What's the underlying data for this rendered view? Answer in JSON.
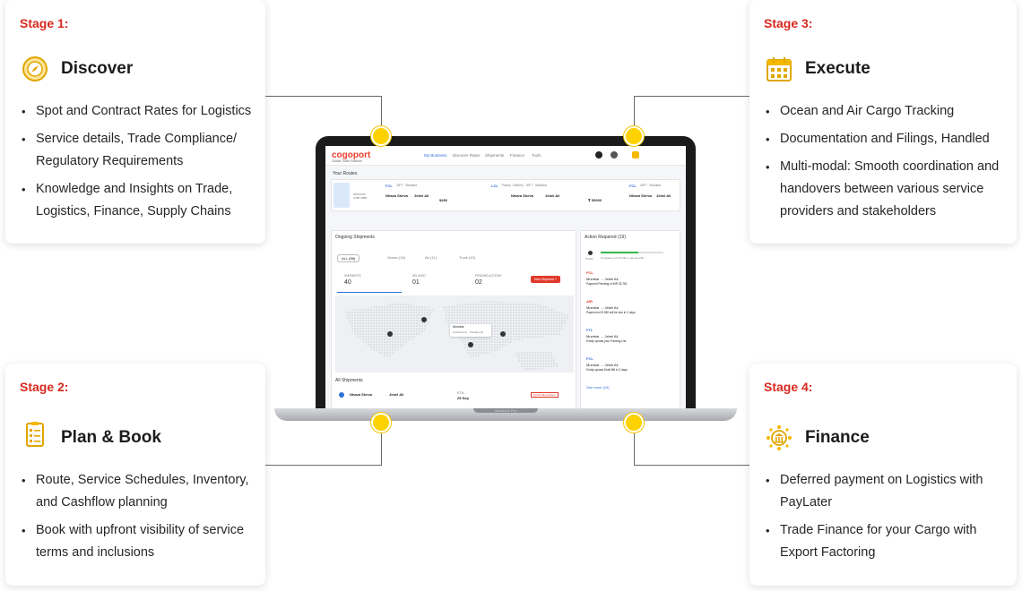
{
  "stages": [
    {
      "label": "Stage 1:",
      "title": "Discover",
      "icon": "compass-icon",
      "bullets": [
        "Spot and Contract Rates for Logistics",
        "Service details, Trade Compliance/ Regulatory Requirements",
        "Knowledge and Insights on Trade, Logistics, Finance, Supply Chains"
      ]
    },
    {
      "label": "Stage 2:",
      "title": "Plan & Book",
      "icon": "clipboard-checklist-icon",
      "bullets": [
        "Route, Service Schedules, Inventory, and Cashflow planning",
        "Book with upfront visibility of service terms and inclusions"
      ]
    },
    {
      "label": "Stage 3:",
      "title": "Execute",
      "icon": "calendar-icon",
      "bullets": [
        "Ocean and Air Cargo Tracking",
        "Documentation and Filings, Handled",
        "Multi-modal: Smooth coordination and handovers between various service providers and stakeholders"
      ]
    },
    {
      "label": "Stage 4:",
      "title": "Finance",
      "icon": "bank-network-icon",
      "bullets": [
        "Deferred payment on Logistics with PayLater",
        "Trade Finance for your Cargo with Export Factoring"
      ]
    }
  ],
  "colors": {
    "accent_red": "#d8281e",
    "connector_yellow": "#fdd200",
    "icon_yellow": "#f5b800"
  },
  "screen": {
    "logo": "cogoport",
    "logo_sub": "Global Trade Platform",
    "nav": [
      "My Business",
      "Discover Rates",
      "Shipments",
      "Finance",
      "Tools"
    ],
    "your_routes": "Your Routes",
    "add_route": "Add more route rates",
    "routes": [
      {
        "mode": "FCL",
        "meta": "20FT · Standard",
        "origin": "Nhava Sheva",
        "origin_city": "Mumbai",
        "dest": "Jebel Ali",
        "dest_city": "Dubai",
        "price": "$490"
      },
      {
        "mode": "LCL",
        "meta": "Pickup · Delivery · 20FT · Standard",
        "origin": "Nhava Sheva",
        "origin_city": "Mumbai",
        "dest": "Jebel Ali",
        "dest_city": "Dubai",
        "price": "₹ 53000"
      },
      {
        "mode": "FCL",
        "meta": "40FT · Standard",
        "origin": "Nhava Sheva",
        "origin_city": "Mumbai",
        "dest": "Jebel Ali",
        "dest_city": "Dubai",
        "price": ""
      }
    ],
    "ongoing_title": "Ongoing Shipments",
    "filters": [
      "ALL (88)",
      "Ocean (15)",
      "Air (11)",
      "Truck (10)"
    ],
    "stats": [
      {
        "label": "SHIPMENTS",
        "value": "40"
      },
      {
        "label": "DELAYED",
        "value": "01"
      },
      {
        "label": "PENDING ACTIONS",
        "value": "02"
      }
    ],
    "new_shipment": "New Shipment  +",
    "map_tooltip": "Mumbai",
    "map_tooltip_sub": "Onboard (4) · Pending (6)",
    "all_shipments": "All Shipments",
    "shipment_row": {
      "origin": "Nhava Sheva",
      "dest": "Jebel Ali",
      "eta_label": "ETA",
      "eta": "25 Sep",
      "badge": "(2) Pending Action"
    },
    "action_title": "Action Required (19)",
    "action_profile": "Profile",
    "action_profile_text": "Complete your Profile to get benefits",
    "actions": [
      {
        "tag": "FCL",
        "route": "Mumbai → Jebel Ali",
        "text": "Payment Pending of INR 52,781"
      },
      {
        "tag": "AIR",
        "route": "Mumbai → Jebel Ali",
        "text": "Payment of $ 380 will be due in 2 days"
      },
      {
        "tag": "FTL",
        "route": "Mumbai → Jebel Ali",
        "text": "Kindly upload your Packing List"
      },
      {
        "tag": "FCL",
        "route": "Mumbai → Jebel Ali",
        "text": "Kindly upload Draft Bill in 3 days"
      }
    ],
    "see_more": "See more (15)",
    "macbook": "MacBook Pro"
  }
}
